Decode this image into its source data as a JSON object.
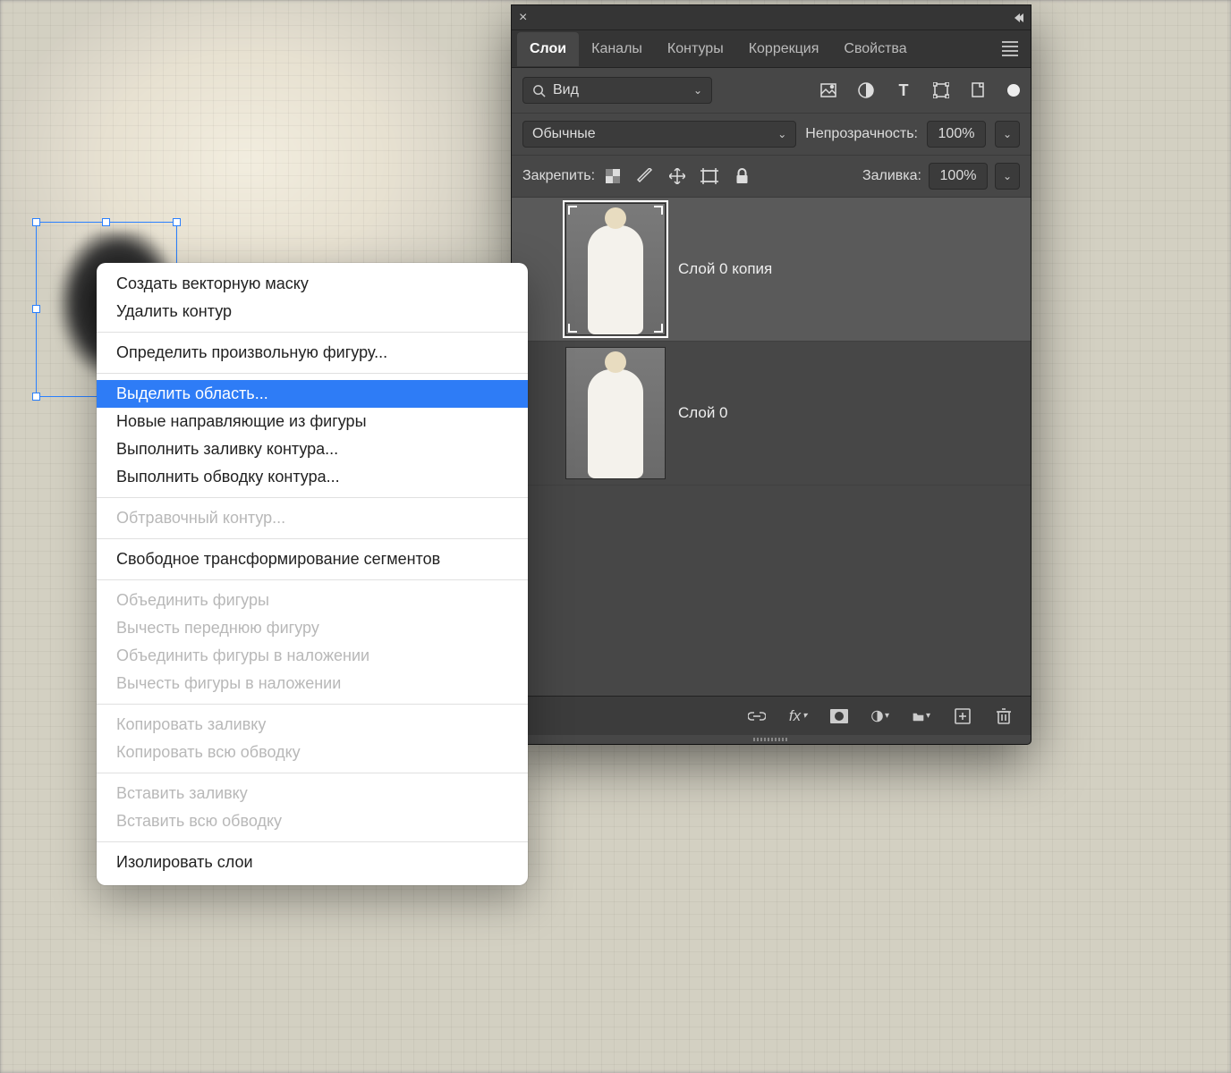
{
  "contextMenu": {
    "items": [
      {
        "label": "Создать векторную маску",
        "enabled": true
      },
      {
        "label": "Удалить контур",
        "enabled": true
      },
      {
        "sep": true
      },
      {
        "label": "Определить произвольную фигуру...",
        "enabled": true
      },
      {
        "sep": true
      },
      {
        "label": "Выделить область...",
        "enabled": true,
        "highlighted": true
      },
      {
        "label": "Новые направляющие из фигуры",
        "enabled": true
      },
      {
        "label": "Выполнить заливку контура...",
        "enabled": true
      },
      {
        "label": "Выполнить обводку контура...",
        "enabled": true
      },
      {
        "sep": true
      },
      {
        "label": "Обтравочный контур...",
        "enabled": false
      },
      {
        "sep": true
      },
      {
        "label": "Свободное трансформирование сегментов",
        "enabled": true
      },
      {
        "sep": true
      },
      {
        "label": "Объединить фигуры",
        "enabled": false
      },
      {
        "label": "Вычесть переднюю фигуру",
        "enabled": false
      },
      {
        "label": "Объединить фигуры в наложении",
        "enabled": false
      },
      {
        "label": "Вычесть фигуры в наложении",
        "enabled": false
      },
      {
        "sep": true
      },
      {
        "label": "Копировать заливку",
        "enabled": false
      },
      {
        "label": "Копировать всю обводку",
        "enabled": false
      },
      {
        "sep": true
      },
      {
        "label": "Вставить заливку",
        "enabled": false
      },
      {
        "label": "Вставить всю обводку",
        "enabled": false
      },
      {
        "sep": true
      },
      {
        "label": "Изолировать слои",
        "enabled": true
      }
    ]
  },
  "panel": {
    "tabs": [
      "Слои",
      "Каналы",
      "Контуры",
      "Коррекция",
      "Свойства"
    ],
    "activeTab": 0,
    "searchLabel": "Вид",
    "blendMode": "Обычные",
    "opacityLabel": "Непрозрачность:",
    "opacityValue": "100%",
    "lockLabel": "Закрепить:",
    "fillLabel": "Заливка:",
    "fillValue": "100%",
    "layers": [
      {
        "name": "Слой 0 копия",
        "selected": true
      },
      {
        "name": "Слой 0",
        "selected": false
      }
    ]
  }
}
